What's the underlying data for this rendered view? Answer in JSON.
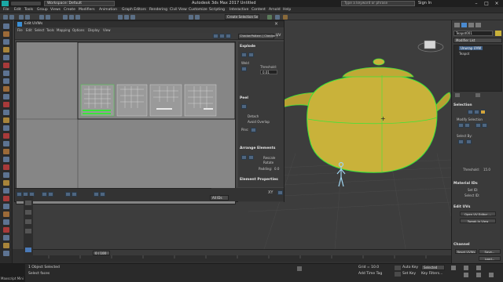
{
  "app": {
    "title": "Autodesk 3ds Max 2017    Untitled",
    "workspace": "Workspace: Default",
    "search_placeholder": "Type a keyword or phrase",
    "sign_in": "Sign In"
  },
  "menu": [
    "File",
    "Edit",
    "Tools",
    "Group",
    "Views",
    "Create",
    "Modifiers",
    "Animation",
    "Graph Editors",
    "Rendering",
    "Civil View",
    "Customize",
    "Scripting",
    "Interactive",
    "Content",
    "Arnold",
    "Help"
  ],
  "toolbar": {
    "create_selection_set": "Create Selection Se"
  },
  "uvw": {
    "title": "Edit UVWs",
    "menu": [
      "File",
      "Edit",
      "Select",
      "Tools",
      "Mapping",
      "Options",
      "Display",
      "View"
    ],
    "checker_dropdown": "CheckerPattern  ( Checker )",
    "uv_label": "UV",
    "explode_head": "Explode",
    "weld_label": "Weld",
    "threshold_label": "Threshold:",
    "threshold_value": "0.01",
    "peel_head": "Peel",
    "detach_label": "Detach",
    "avoid_overlap_label": "Avoid Overlap",
    "pins_label": "Pins:",
    "arrange_head": "Arrange Elements",
    "rescale_label": "Rescale",
    "rotate_label": "Rotate",
    "padding_label": "Padding:",
    "padding_value": "0.0",
    "elem_props_head": "Element Properties",
    "rescale_priority": "Rescale Priority:",
    "groups_label": "Groups:",
    "xy_label": "XY",
    "all_ids": "All IDs"
  },
  "cmdpanel": {
    "object_name": "Teapot001",
    "modifier_list": "Modifier List",
    "stack_items": [
      "Unwrap UVW",
      "Teapot"
    ],
    "selection_head": "Selection",
    "modify_selection": "Modify Selection",
    "select_by": "Select By:",
    "threshold_label": "Threshold:",
    "threshold_value": "15.0",
    "material_ids_head": "Material IDs",
    "set_id": "Set ID:",
    "select_id": "Select ID:",
    "edit_uvs_head": "Edit UVs",
    "open_uv_editor": "Open UV Editor ...",
    "tweak_in_view": "Tweak In View",
    "channel_head": "Channel",
    "reset_uvws": "Reset UVWs",
    "save": "Save...",
    "load": "Load..."
  },
  "viewport": {
    "label": "[+] [Perspective] [Standard] [Default Shading]"
  },
  "timeline": {
    "frame": "0 / 100"
  },
  "status": {
    "selected": "1 Object Selected",
    "prompt": "Select faces",
    "grid": "Grid = 10.0",
    "add_time_tag": "Add Time Tag",
    "auto_key": "Auto Key",
    "set_key": "Set Key",
    "key_filters": "Key Filters...",
    "selected_dropdown": "Selected",
    "maxscript": "Maxscript Mini"
  },
  "colors": {
    "teapot": "#c9b23a",
    "wire": "#39e639",
    "accent": "#5b8fc7"
  }
}
